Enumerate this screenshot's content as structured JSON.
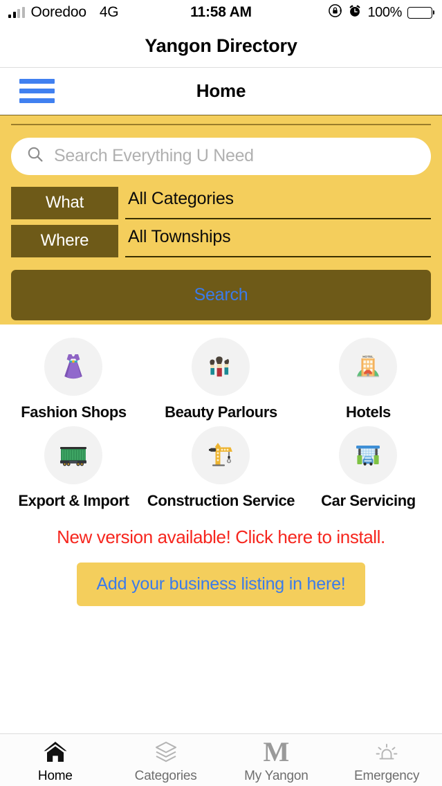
{
  "status_bar": {
    "carrier": "Ooredoo",
    "network": "4G",
    "time": "11:58 AM",
    "battery_percent": "100%",
    "rotation_lock_icon": "rotation-lock-icon",
    "alarm_icon": "alarm-clock-icon",
    "signal_icon": "signal-bars-icon",
    "battery_icon": "battery-icon"
  },
  "app": {
    "title": "Yangon Directory"
  },
  "navbar": {
    "title": "Home",
    "menu_icon": "hamburger-menu-icon",
    "menu_color": "#4080f0"
  },
  "search_panel": {
    "background_color": "#f4ce5c",
    "search_placeholder": "Search Everything U Need",
    "search_value": "",
    "search_icon": "search-icon",
    "filters": [
      {
        "key": "What",
        "value": "All Categories"
      },
      {
        "key": "Where",
        "value": "All Townships"
      }
    ],
    "search_button_label": "Search",
    "search_button_color": "#6e5a18",
    "search_button_text_color": "#3b7bea"
  },
  "categories": [
    {
      "label": "Fashion Shops",
      "icon": "dress-icon"
    },
    {
      "label": "Beauty Parlours",
      "icon": "makeup-brushes-icon"
    },
    {
      "label": "Hotels",
      "icon": "hotel-building-icon"
    },
    {
      "label": "Export & Import",
      "icon": "freight-container-icon"
    },
    {
      "label": "Construction Service",
      "icon": "crane-icon"
    },
    {
      "label": "Car Servicing",
      "icon": "car-wash-icon"
    }
  ],
  "notices": {
    "update_text": "New version available! Click here to install.",
    "update_color": "#f6261e",
    "add_listing_label": "Add your business listing in here!",
    "add_listing_bg": "#f4ce5c",
    "add_listing_text_color": "#3b7bea"
  },
  "tabbar": {
    "items": [
      {
        "label": "Home",
        "icon": "home-icon",
        "active": true
      },
      {
        "label": "Categories",
        "icon": "layers-icon",
        "active": false
      },
      {
        "label": "My Yangon",
        "icon": "letter-m-icon",
        "active": false
      },
      {
        "label": "Emergency",
        "icon": "siren-icon",
        "active": false
      }
    ]
  },
  "hotel_sign_text": "HOTEL"
}
